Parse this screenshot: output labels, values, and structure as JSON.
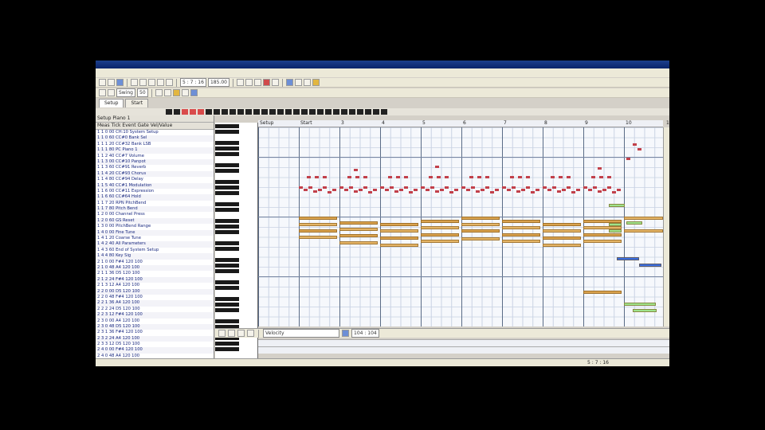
{
  "window": {
    "title": ""
  },
  "menu": [],
  "toolbar": {
    "field1": "5 : 7 : 16",
    "field2": "185.00",
    "field3": "Swing",
    "field4": "50"
  },
  "tabs": [
    {
      "label": "Setup",
      "selected": true
    },
    {
      "label": "Start",
      "selected": false
    }
  ],
  "track_list": {
    "title": "Setup Piano 1",
    "columns": "Meas  Tick  Event   Gate  Vel/Value",
    "rows": [
      "1  1  0  00  CH:10  System Setup",
      "1  1  0  60  CC#0  Bank Sel",
      "1  1  1  20  CC#32  Bank LSB",
      "1  1  1  80  PC  Piano 1",
      "1  1  2  40  CC#7  Volume",
      "1  1  3  00  CC#10  Panpot",
      "1  1  3  60  CC#91  Reverb",
      "1  1  4  20  CC#93  Chorus",
      "1  1  4  80  CC#94  Delay",
      "1  1  5  40  CC#1  Modulation",
      "1  1  6  00  CC#11  Expression",
      "1  1  6  60  CC#64  Hold",
      "1  1  7  20  RPN  PitchBend",
      "1  1  7  80  Pitch Bend",
      "1  2  0  00  Channel Press",
      "1  2  0  60  GS Reset",
      "1  3  0  00  PitchBend Range",
      "1  4  0  00  Fine Tune",
      "1  4  1  20  Coarse Tune",
      "1  4  2  40  All Parameters",
      "1  4  3  60  End of System Setup",
      "1  4  4  80  Key Sig",
      "2  1  0  00  F#4  120  100",
      "2  1  0  48  A4  120  100",
      "2  1  1  36  D5  120  100",
      "2  1  2  24  F#4  120  100",
      "2  1  3  12  A4  120  100",
      "2  2  0  00  D5  120  100",
      "2  2  0  48  F#4  120  100",
      "2  2  1  36  A4  120  100",
      "2  2  2  24  D5  120  100",
      "2  2  3  12  F#4  120  100",
      "2  3  0  00  A4  120  100",
      "2  3  0  48  D5  120  100",
      "2  3  1  36  F#4  120  100",
      "2  3  2  24  A4  120  100",
      "2  3  3  12  D5  120  100",
      "2  4  0  00  F#4  120  100",
      "2  4  0  48  A4  120  100",
      "2  4  1  36  D5  120  100",
      "2  4  2  24  F#4  120  100"
    ]
  },
  "ruler": {
    "labels": [
      "Setup",
      "Start",
      "3",
      "4",
      "5",
      "6",
      "7",
      "8",
      "9",
      "10",
      "11"
    ]
  },
  "bottombar": {
    "dropdown": "Velocity",
    "readout": "104 : 104"
  },
  "status": {
    "text": "5 : 7 : 16"
  },
  "colors": {
    "note": "#e4b466",
    "note_dark": "#d9a24e",
    "green": "#9ee38a",
    "blue": "#3a6ee0",
    "dot": "#c2404a"
  }
}
